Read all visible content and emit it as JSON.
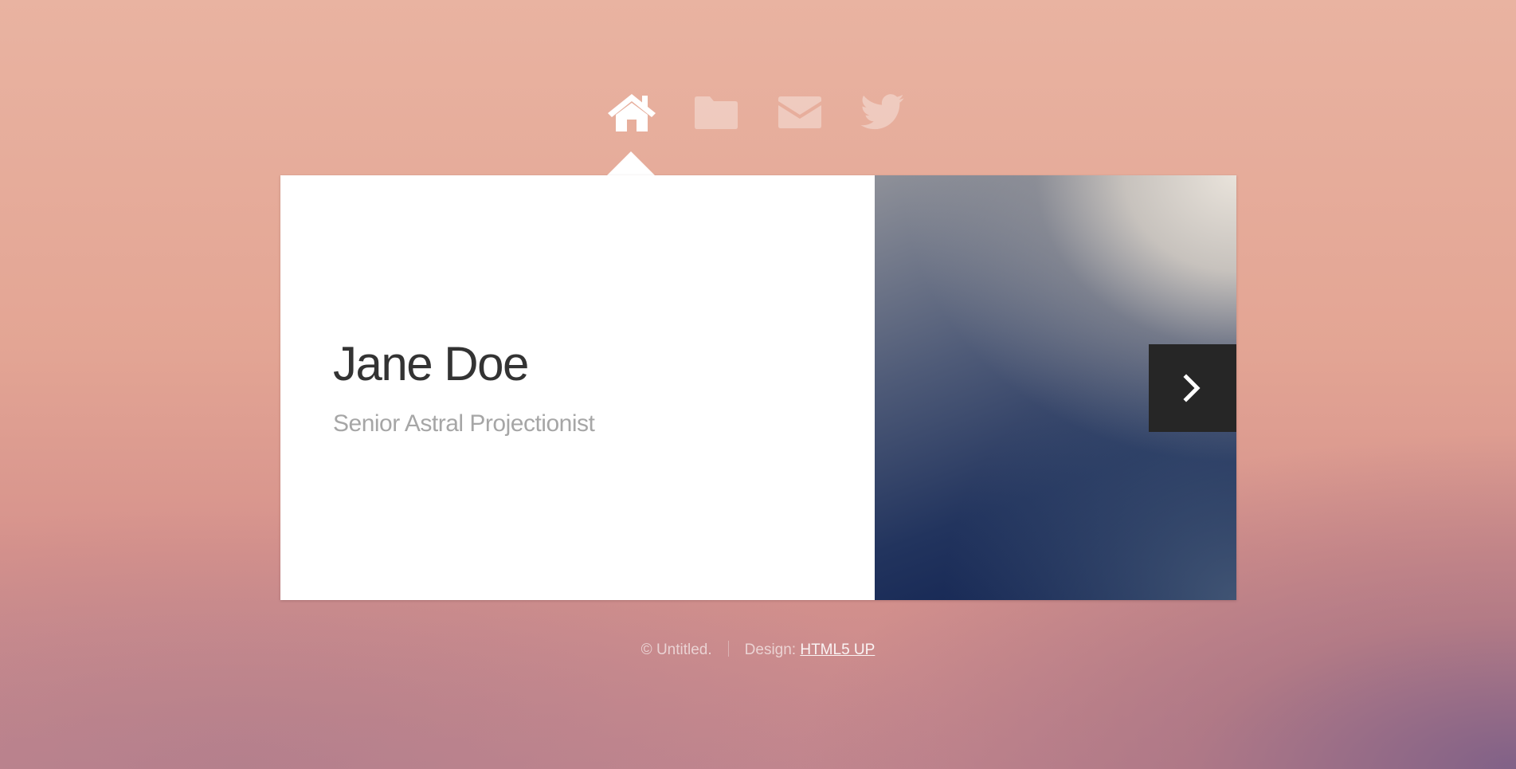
{
  "nav": {
    "items": [
      {
        "icon": "home-icon",
        "active": true
      },
      {
        "icon": "folder-icon",
        "active": false
      },
      {
        "icon": "envelope-icon",
        "active": false
      },
      {
        "icon": "twitter-icon",
        "active": false
      }
    ]
  },
  "main": {
    "title": "Jane Doe",
    "subtitle": "Senior Astral Projectionist",
    "next_icon": "chevron-right-icon"
  },
  "footer": {
    "copyright": "© Untitled.",
    "design_label": "Design:",
    "design_link": "HTML5 UP"
  },
  "colors": {
    "panel_bg": "#ffffff",
    "title": "#333333",
    "subtitle": "#a6a6a6",
    "next_button_bg": "#262626",
    "nav_active": "#ffffff",
    "nav_inactive": "rgba(255,255,255,0.35)"
  }
}
